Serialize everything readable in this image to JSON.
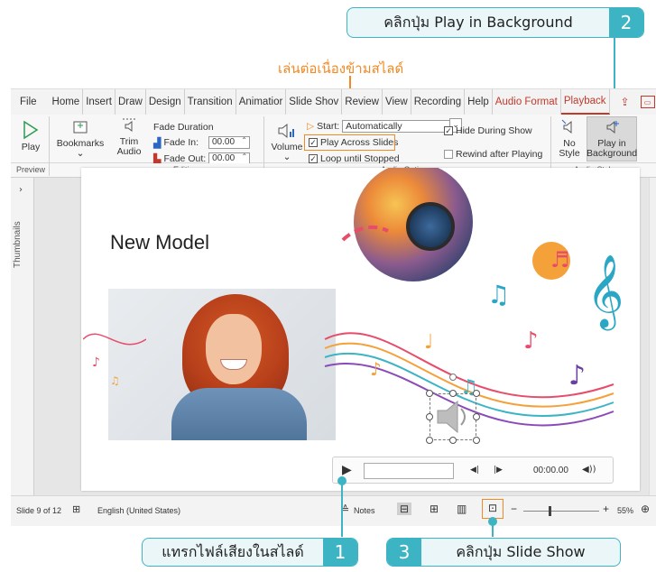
{
  "annotations": {
    "step1": {
      "text": "แทรกไฟล์เสียงในสไลด์",
      "num": "1"
    },
    "step2": {
      "text": "คลิกปุ่ม Play in Background",
      "num": "2"
    },
    "step3": {
      "text": "คลิกปุ่ม Slide Show",
      "num": "3"
    },
    "orange_note": "เล่นต่อเนื่องข้ามสไลด์"
  },
  "menu": {
    "tabs": [
      "File",
      "Home",
      "Insert",
      "Draw",
      "Design",
      "Transition",
      "Animatior",
      "Slide Shov",
      "Review",
      "View",
      "Recording",
      "Help",
      "Audio Format",
      "Playback"
    ]
  },
  "ribbon": {
    "play": "Play",
    "bookmarks": "Bookmarks",
    "trim_audio_1": "Trim",
    "trim_audio_2": "Audio",
    "fade_duration": "Fade Duration",
    "fade_in_label": "Fade In:",
    "fade_in_value": "00.00",
    "fade_out_label": "Fade Out:",
    "fade_out_value": "00.00",
    "volume": "Volume",
    "start_label": "Start:",
    "start_value": "Automatically",
    "play_across_slides": "Play Across Slides",
    "loop_until_stopped": "Loop until Stopped",
    "hide_during_show": "Hide During Show",
    "rewind_after_playing": "Rewind after Playing",
    "no_style_1": "No",
    "no_style_2": "Style",
    "play_bg_1": "Play in",
    "play_bg_2": "Background",
    "groups": {
      "preview": "Preview",
      "editing": "Editing",
      "audio_options": "Audio Options",
      "audio_styles": "Audio Styles"
    }
  },
  "sidebar": {
    "thumbnails": "Thumbnails"
  },
  "slide": {
    "title": "New Model"
  },
  "player": {
    "time": "00:00.00"
  },
  "status": {
    "slide_counter": "Slide 9 of 12",
    "language": "English (United States)",
    "notes": "Notes",
    "zoom": "55%"
  },
  "colors": {
    "accent_teal": "#3cb4c4",
    "accent_orange": "#f08a24",
    "playback_red": "#c0392b"
  }
}
